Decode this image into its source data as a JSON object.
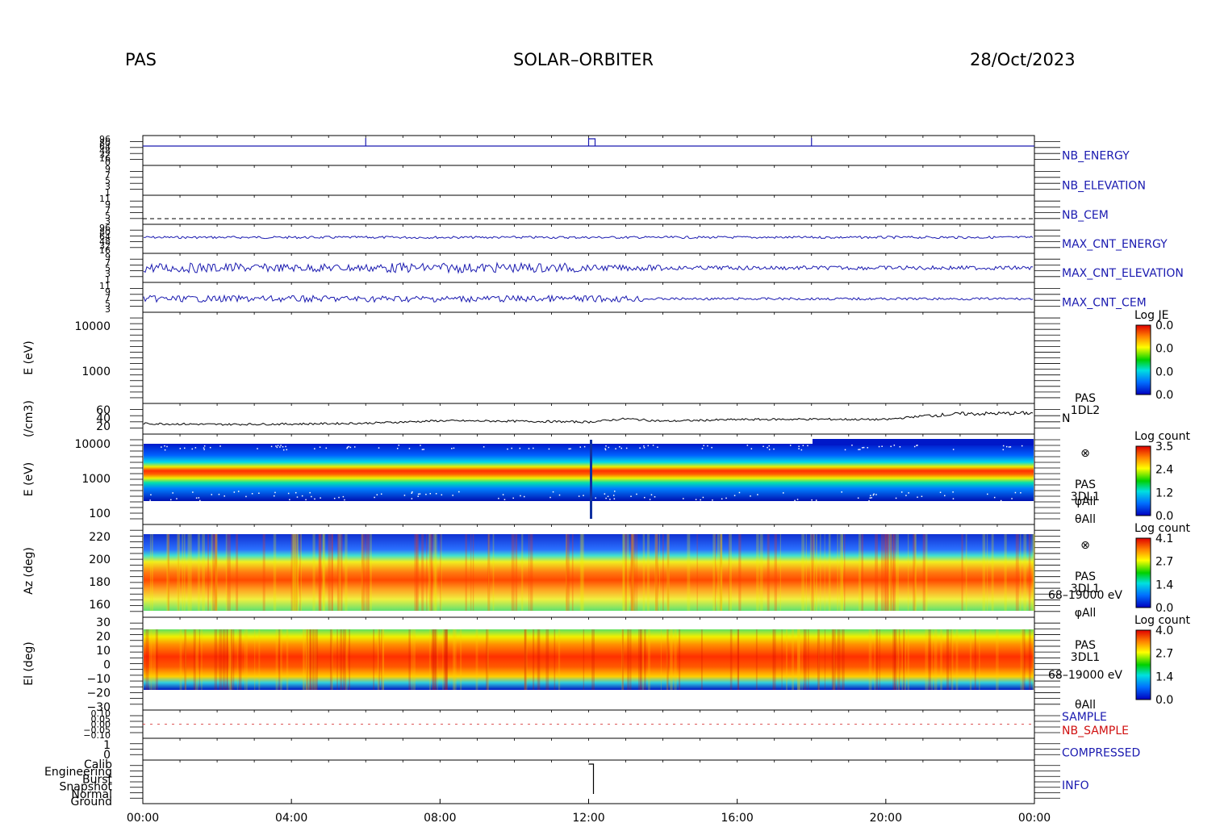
{
  "header": {
    "instrument": "PAS",
    "mission": "SOLAR–ORBITER",
    "date": "28/Oct/2023"
  },
  "colors": {
    "blue": "#1a1ab0",
    "red": "#d01010",
    "black": "#000000"
  },
  "chart_data": [
    {
      "type": "line",
      "name": "NB_ENERGY",
      "label": "NB_ENERGY",
      "label_color": "#1a1ab0",
      "yticks": [
        "96",
        "80",
        "64",
        "48",
        "32",
        "16",
        "0"
      ],
      "events": [
        "06:00",
        "12:00",
        "18:00"
      ]
    },
    {
      "type": "line",
      "name": "NB_ELEVATION",
      "label": "NB_ELEVATION",
      "label_color": "#1a1ab0",
      "yticks": [
        "9",
        "7",
        "5",
        "3",
        "1"
      ]
    },
    {
      "type": "line",
      "name": "NB_CEM",
      "label": "NB_CEM",
      "label_color": "#1a1ab0",
      "yticks": [
        "11",
        "9",
        "7",
        "5",
        "3"
      ],
      "reference_line": "dashed"
    },
    {
      "type": "line",
      "name": "MAX_CNT_ENERGY",
      "label": "MAX_CNT_ENERGY",
      "label_color": "#1a1ab0",
      "yticks": [
        "96",
        "80",
        "64",
        "48",
        "32",
        "16"
      ]
    },
    {
      "type": "line",
      "name": "MAX_CNT_ELEVATION",
      "label": "MAX_CNT_ELEVATION",
      "label_color": "#1a1ab0",
      "yticks": [
        "9",
        "7",
        "5",
        "3",
        "1"
      ]
    },
    {
      "type": "line",
      "name": "MAX_CNT_CEM",
      "label": "MAX_CNT_CEM",
      "label_color": "#1a1ab0",
      "yticks": [
        "11",
        "9",
        "7",
        "5",
        "3"
      ]
    },
    {
      "type": "heatmap",
      "name": "E-spectrogram-L2",
      "ylabel": "E (eV)",
      "yticks": [
        "10000",
        "1000"
      ],
      "colorbar": {
        "title": "Log JE",
        "ticks": [
          "0.0",
          "0.0",
          "0.0",
          "0.0"
        ]
      }
    },
    {
      "type": "line",
      "name": "N",
      "ylabel": "(/cm3)",
      "yticks": [
        "60",
        "40",
        "20"
      ],
      "label_lines": [
        "PAS",
        "1DL2"
      ],
      "series_label": "N",
      "x": [
        "00:00",
        "02:00",
        "04:00",
        "06:00",
        "08:00",
        "10:00",
        "12:00",
        "13:00",
        "14:00",
        "16:00",
        "18:00",
        "20:00",
        "21:00",
        "22:00",
        "24:00"
      ],
      "values": [
        26,
        24,
        25,
        27,
        33,
        32,
        30,
        38,
        32,
        36,
        37,
        36,
        45,
        50,
        52
      ]
    },
    {
      "type": "heatmap",
      "name": "E-spectrogram-L1",
      "ylabel": "E (eV)",
      "yticks": [
        "10000",
        "1000",
        "100"
      ],
      "label_lines": [
        "⊗",
        "PAS",
        "3DL1",
        "φAll",
        "θAll"
      ],
      "colorbar": {
        "title": "Log count",
        "ticks": [
          "3.5",
          "2.4",
          "1.2",
          "0.0"
        ]
      }
    },
    {
      "type": "heatmap",
      "name": "Az-spectrogram",
      "ylabel": "Az (deg)",
      "yticks": [
        "220",
        "200",
        "180",
        "160"
      ],
      "label_lines": [
        "⊗",
        "PAS",
        "3DL1",
        "68–19000 eV",
        "φAll"
      ],
      "colorbar": {
        "title": "Log count",
        "ticks": [
          "4.1",
          "2.7",
          "1.4",
          "0.0"
        ]
      }
    },
    {
      "type": "heatmap",
      "name": "El-spectrogram",
      "ylabel": "El (deg)",
      "yticks": [
        "30",
        "20",
        "10",
        "0",
        "−10",
        "−20",
        "−30"
      ],
      "label_lines": [
        "PAS",
        "3DL1",
        "68–19000 eV",
        "θAll"
      ],
      "colorbar": {
        "title": "Log count",
        "ticks": [
          "4.0",
          "2.7",
          "1.4",
          "0.0"
        ]
      }
    },
    {
      "type": "line",
      "name": "SAMPLE",
      "yticks": [
        "0.10",
        "0.05",
        "0.00",
        "−0.05",
        "−0.10"
      ],
      "labels": [
        {
          "text": "SAMPLE",
          "color": "#1a1ab0"
        },
        {
          "text": "NB_SAMPLE",
          "color": "#d01010"
        }
      ]
    },
    {
      "type": "line",
      "name": "COMPRESSED",
      "label": "COMPRESSED",
      "label_color": "#1a1ab0",
      "yticks": [
        "1",
        "0"
      ]
    },
    {
      "type": "line",
      "name": "INFO",
      "label": "INFO",
      "label_color": "#1a1ab0",
      "yticks": [
        "Calib",
        "Engineering",
        "Burst",
        "Snapshot",
        "Normal",
        "Ground"
      ]
    }
  ],
  "x_axis": {
    "ticks": [
      "00:00",
      "04:00",
      "08:00",
      "12:00",
      "16:00",
      "20:00",
      "00:00"
    ]
  }
}
